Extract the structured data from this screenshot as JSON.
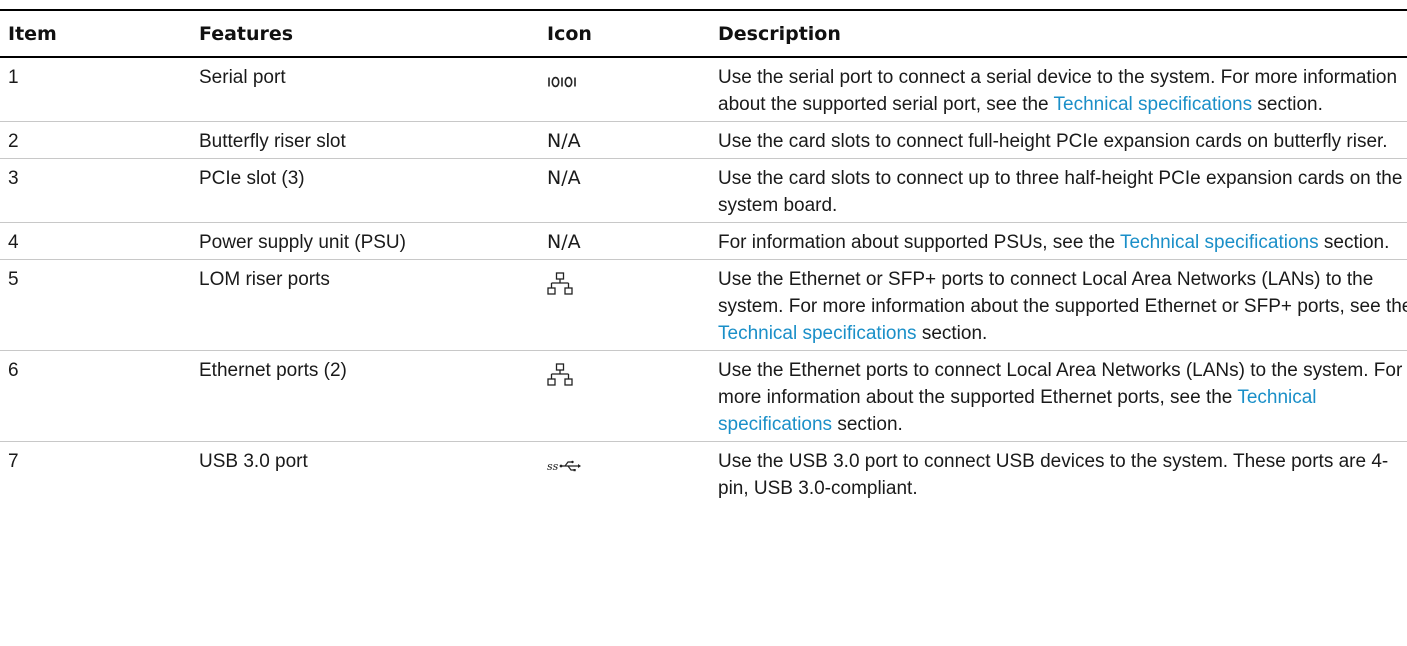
{
  "table": {
    "headers": {
      "item": "Item",
      "features": "Features",
      "icon": "Icon",
      "description": "Description"
    },
    "rows": [
      {
        "item": "1",
        "feature": "Serial port",
        "icon_name": "serial-port-icon",
        "icon_text": "",
        "desc_pre": "Use the serial port to connect a serial device to the system. For more information about the supported serial port, see the ",
        "desc_link": "Technical specifications",
        "desc_post": " section."
      },
      {
        "item": "2",
        "feature": "Butterfly riser slot",
        "icon_name": "",
        "icon_text": "N/A",
        "desc_pre": "Use the card slots to connect full-height PCIe expansion cards on butterfly riser.",
        "desc_link": "",
        "desc_post": ""
      },
      {
        "item": "3",
        "feature": "PCIe slot (3)",
        "icon_name": "",
        "icon_text": "N/A",
        "desc_pre": "Use the card slots to connect up to three half-height PCIe expansion cards on the system board.",
        "desc_link": "",
        "desc_post": ""
      },
      {
        "item": "4",
        "feature": "Power supply unit (PSU)",
        "icon_name": "",
        "icon_text": "N/A",
        "desc_pre": "For information about supported PSUs, see the ",
        "desc_link": "Technical specifications",
        "desc_post": " section."
      },
      {
        "item": "5",
        "feature": "LOM riser ports",
        "icon_name": "network-icon",
        "icon_text": "",
        "desc_pre": "Use the Ethernet or SFP+ ports to connect Local Area Networks (LANs) to the system. For more information about the supported Ethernet or SFP+ ports, see the ",
        "desc_link": "Technical specifications",
        "desc_post": " section."
      },
      {
        "item": "6",
        "feature": "Ethernet ports (2)",
        "icon_name": "network-icon",
        "icon_text": "",
        "desc_pre": "Use the Ethernet ports to connect Local Area Networks (LANs) to the system. For more information about the supported Ethernet ports, see the ",
        "desc_link": "Technical specifications",
        "desc_post": " section."
      },
      {
        "item": "7",
        "feature": "USB 3.0 port",
        "icon_name": "usb-ss-icon",
        "icon_text": "",
        "desc_pre": "Use the USB 3.0 port to connect USB devices to the system. These ports are 4-pin, USB 3.0-compliant.",
        "desc_link": "",
        "desc_post": ""
      }
    ]
  },
  "colors": {
    "link": "#1a8fc8",
    "text": "#1a1a1a",
    "rule": "#000000"
  }
}
